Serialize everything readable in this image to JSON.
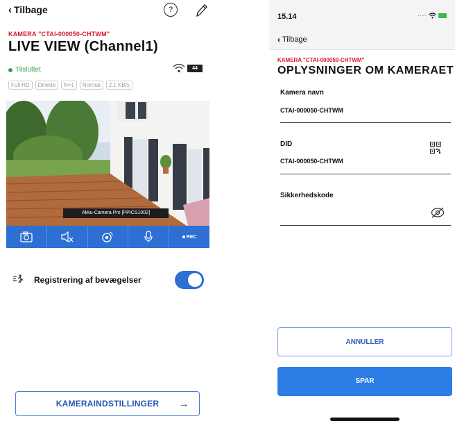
{
  "left": {
    "back_label": "Tilbage",
    "help_glyph": "?",
    "camera_name": "KAMERA \"CTAI-000050-CHTWM\"",
    "title": "LIVE VIEW  (Channel1)",
    "status": "Tilsluttet",
    "battery": "44",
    "chips": [
      "Full HD",
      "Direkte",
      "N=1",
      "Normal",
      "2.1 KB/s"
    ],
    "video_label": "Akku-Camera Pro [PPICS1002]",
    "rec_label": "REC",
    "motion_label": "Registrering af bevægelser",
    "motion_enabled": true,
    "settings_button": "KAMERAINDSTILLINGER",
    "settings_arrow": "→",
    "accent": "#2d6fd3",
    "brand_red": "#d61a2e"
  },
  "right": {
    "time": "15.14",
    "back_label": "Tilbage",
    "camera_name": "KAMERA \"CTAI-000050-CHTWM\"",
    "title": "OPLYSNINGER OM KAMERAET",
    "fields": {
      "name_label": "Kamera navn",
      "name_value": "CTAI-000050-CHTWM",
      "did_label": "DID",
      "did_value": "CTAI-000050-CHTWM",
      "security_label": "Sikkerhedskode",
      "security_value": ""
    },
    "cancel_button": "ANNULLER",
    "save_button": "SPAR"
  }
}
